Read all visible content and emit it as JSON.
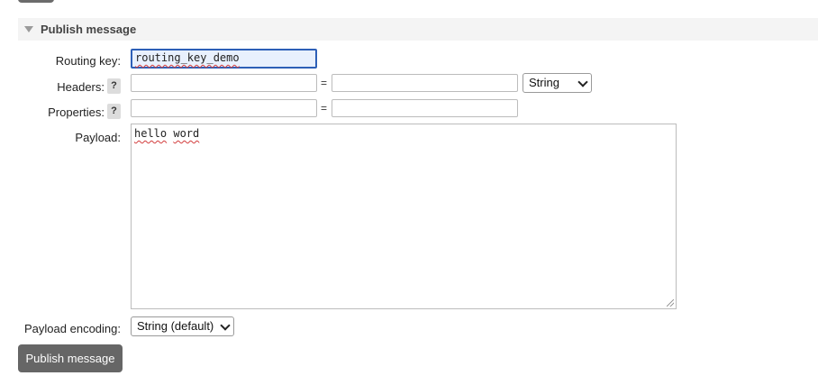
{
  "section": {
    "title": "Publish message"
  },
  "routing": {
    "label": "Routing key:",
    "value": "routing_key_demo"
  },
  "headers": {
    "label": "Headers:",
    "help": "?",
    "key_value": "",
    "eq": "=",
    "val_value": "",
    "type_selected": "String"
  },
  "properties": {
    "label": "Properties:",
    "help": "?",
    "key_value": "",
    "eq": "=",
    "val_value": ""
  },
  "payload": {
    "label": "Payload:",
    "word1": "hello",
    "word2": "word"
  },
  "encoding": {
    "label": "Payload encoding:",
    "selected": "String (default)"
  },
  "actions": {
    "publish_label": "Publish message"
  }
}
